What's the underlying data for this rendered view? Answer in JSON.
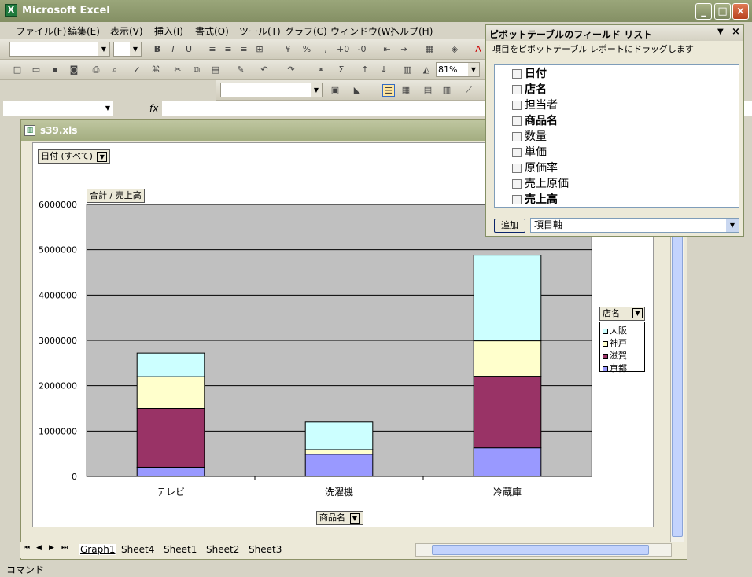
{
  "window": {
    "title": "Microsoft Excel",
    "icon_text": "X"
  },
  "menu": [
    "ファイル(F)",
    "編集(E)",
    "表示(V)",
    "挿入(I)",
    "書式(O)",
    "ツール(T)",
    "グラフ(C)",
    "ウィンドウ(W)",
    "ヘルプ(H)"
  ],
  "toolbar": {
    "zoom": "81%",
    "formula_fx": "fx"
  },
  "workbook": {
    "title": "s39.xls"
  },
  "chart": {
    "page_field_label": "日付",
    "page_field_value": "(すべて)",
    "data_field_label": "合計 / 売上高",
    "category_field_label": "商品名",
    "legend_title": "店名"
  },
  "chart_data": {
    "type": "bar",
    "stacked": true,
    "categories": [
      "テレビ",
      "洗濯機",
      "冷蔵庫"
    ],
    "series": [
      {
        "name": "京都",
        "values": [
          200000,
          490000,
          630000
        ],
        "color": "#9999ff"
      },
      {
        "name": "滋賀",
        "values": [
          1300000,
          0,
          1580000
        ],
        "color": "#993366"
      },
      {
        "name": "神戸",
        "values": [
          700000,
          100000,
          780000
        ],
        "color": "#ffffcc"
      },
      {
        "name": "大阪",
        "values": [
          520000,
          610000,
          1890000
        ],
        "color": "#ccffff"
      }
    ],
    "yticks": [
      "0",
      "1000000",
      "2000000",
      "3000000",
      "4000000",
      "5000000",
      "6000000"
    ],
    "ylim": [
      0,
      6000000
    ],
    "grid": true,
    "legend_position": "right",
    "plot_background": "#c0c0c0"
  },
  "sheet_tabs": [
    "Graph1",
    "Sheet4",
    "Sheet1",
    "Sheet2",
    "Sheet3"
  ],
  "status": {
    "text": "コマンド"
  },
  "pivot_panel": {
    "title": "ピボットテーブルのフィールド リスト",
    "instruction": "項目をピボットテーブル レポートにドラッグします",
    "fields": [
      "日付",
      "店名",
      "担当者",
      "商品名",
      "数量",
      "単価",
      "原価率",
      "売上原価",
      "売上高"
    ],
    "add_button": "追加",
    "axis_select": "項目軸"
  }
}
